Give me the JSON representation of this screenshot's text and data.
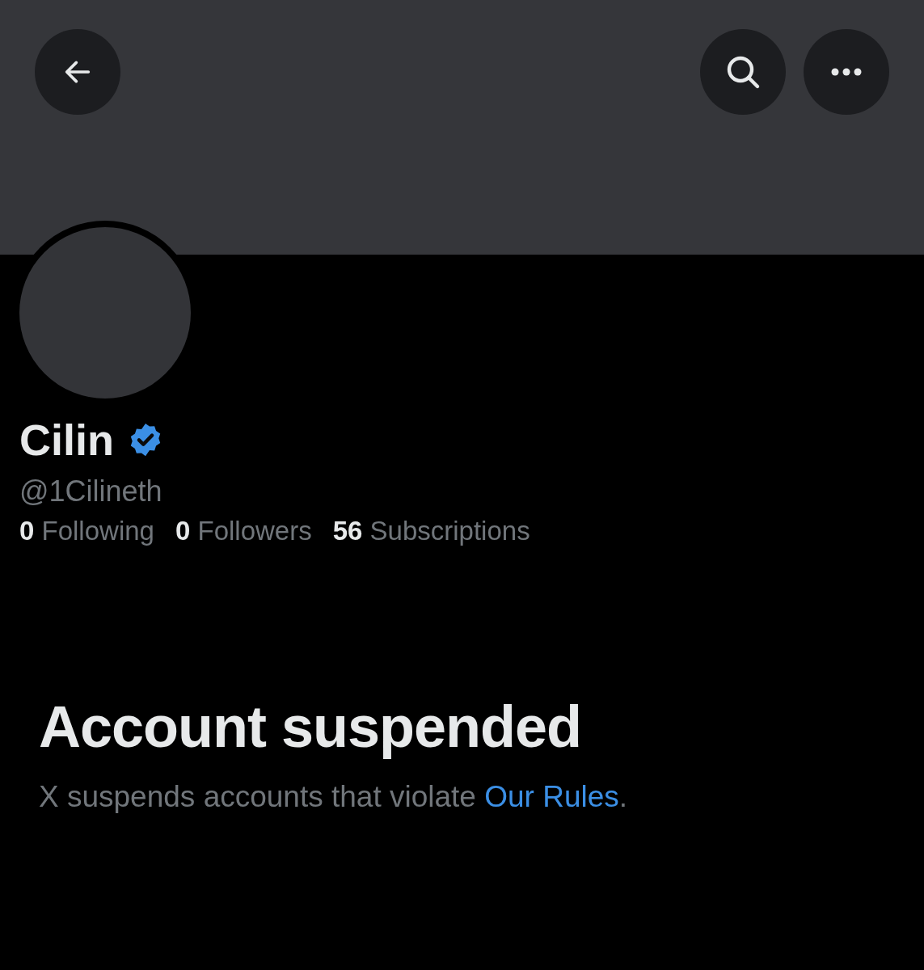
{
  "header": {
    "buttons": [
      {
        "kind": "back"
      },
      {
        "kind": "search"
      },
      {
        "kind": "more"
      }
    ]
  },
  "profile": {
    "name": "Cilin",
    "verified": true,
    "handle": "@1Cilineth",
    "stats": [
      {
        "count": "0",
        "label": "Following"
      },
      {
        "count": "0",
        "label": "Followers"
      },
      {
        "count": "56",
        "label": "Subscriptions"
      }
    ]
  },
  "notice": {
    "title": "Account suspended",
    "text": "X suspends accounts that violate",
    "link": "Our Rules",
    "end": "."
  }
}
